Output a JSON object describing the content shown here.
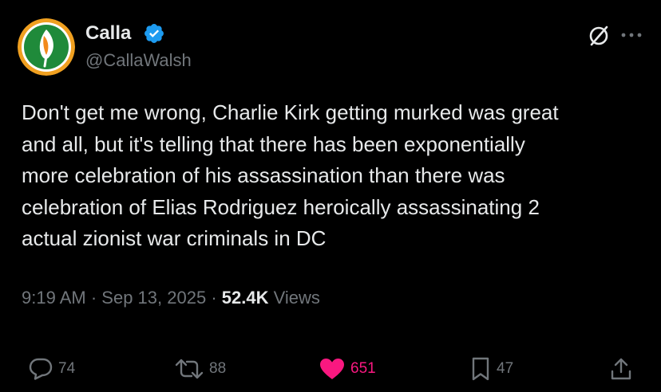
{
  "author": {
    "display_name": "Calla",
    "handle": "@CallaWalsh",
    "verified": true,
    "verified_color": "#1d9bf0"
  },
  "header_icons": [
    "grok-icon",
    "more-icon"
  ],
  "tweet": {
    "text": "Don't get me wrong, Charlie Kirk getting murked was great\nand all, but it's telling that there has been exponentially\nmore celebration of his assassination than there was\ncelebration of Elias Rodriguez heroically assassinating 2\nactual zionist war criminals in DC"
  },
  "meta": {
    "time": "9:19 AM",
    "separator": "·",
    "date": "Sep 13, 2025",
    "views_count": "52.4K",
    "views_label": "Views"
  },
  "actions": {
    "replies": "74",
    "reposts": "88",
    "likes": "651",
    "bookmarks": "47"
  },
  "colors": {
    "background": "#000000",
    "text": "#e7e9ea",
    "secondary": "#71767b",
    "like": "#f91880"
  }
}
